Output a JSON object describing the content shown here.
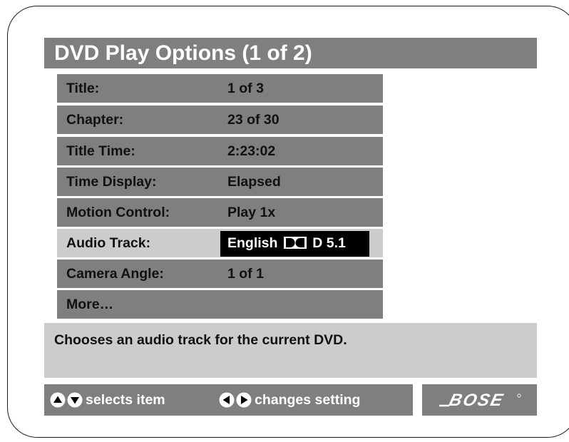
{
  "screen": {
    "title": "DVD Play Options (1 of 2)"
  },
  "options": [
    {
      "label": "Title:",
      "value": "1 of 3"
    },
    {
      "label": "Chapter:",
      "value": "23 of 30"
    },
    {
      "label": "Title Time:",
      "value": "2:23:02"
    },
    {
      "label": "Time Display:",
      "value": "Elapsed"
    },
    {
      "label": "Motion Control:",
      "value": "Play 1x"
    },
    {
      "label": "Audio Track:",
      "value_prefix": "English",
      "value_suffix": "D 5.1",
      "value_icon": "dolby-digital-icon",
      "selected": true
    },
    {
      "label": "Camera Angle:",
      "value": "1 of 1"
    },
    {
      "label": "More…",
      "value": ""
    }
  ],
  "help": {
    "text": "Chooses an audio track for the current DVD."
  },
  "nav": {
    "select_label": "selects item",
    "select_icons": [
      "up-arrow-icon",
      "down-arrow-icon"
    ],
    "change_label": "changes setting",
    "change_icons": [
      "left-arrow-icon",
      "right-arrow-icon"
    ]
  },
  "brand": {
    "logo": "BOSE",
    "logo_icon": "bose-logo"
  },
  "colors": {
    "panel_gray": "#7f7f7f",
    "selected_row": "#cccccc",
    "value_highlight": "#000000"
  }
}
